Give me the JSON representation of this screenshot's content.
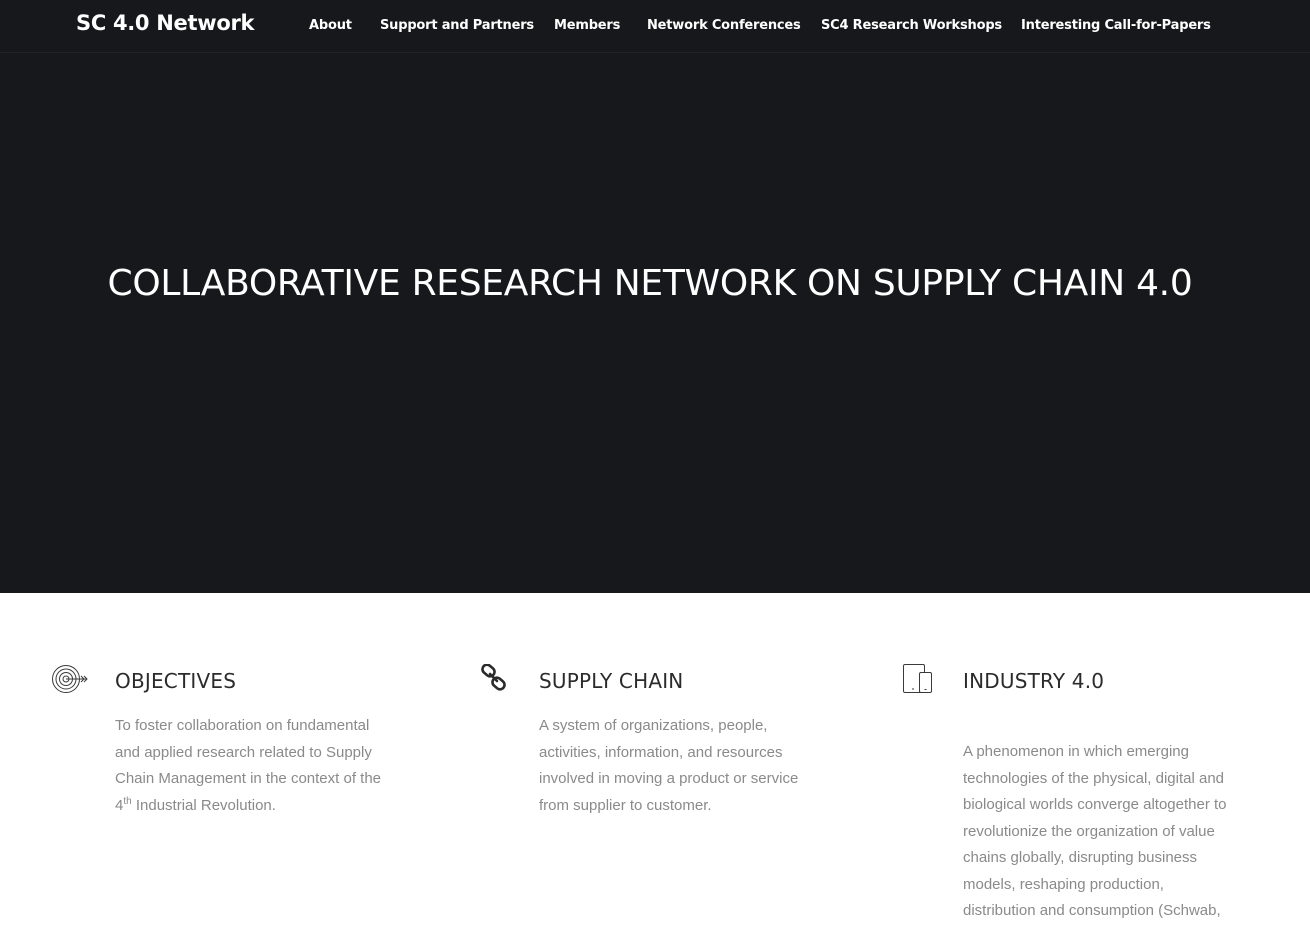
{
  "header": {
    "logo": "SC 4.0 Network",
    "nav": [
      {
        "label": "About"
      },
      {
        "label": "Support and Partners"
      },
      {
        "label": "Members"
      },
      {
        "label": "Network Conferences"
      },
      {
        "label": "SC4 Research Workshops"
      },
      {
        "label": "Interesting Call-for-Papers"
      }
    ]
  },
  "hero": {
    "title": "COLLABORATIVE RESEARCH NETWORK ON SUPPLY CHAIN 4.0"
  },
  "features": [
    {
      "icon": "target-icon",
      "title": "OBJECTIVES",
      "text_before_sup": "To foster collaboration on fundamental and applied research related to Supply Chain Management in the context of the 4",
      "sup": "th",
      "text_after_sup": " Industrial Revolution."
    },
    {
      "icon": "chain-link-icon",
      "title": "SUPPLY CHAIN",
      "text": "A system of organizations, people, activities, information, and resources involved in moving a product or service from supplier to customer."
    },
    {
      "icon": "devices-icon",
      "title": "INDUSTRY 4.0",
      "text": "A phenomenon in which emerging technologies of the physical, digital and biological worlds converge altogether to revolutionize the organization of value chains globally, disrupting business models, reshaping production, distribution and consumption (Schwab,"
    }
  ],
  "colors": {
    "header_bg": "#17181b",
    "hero_bg": "#17181b",
    "body_text": "#8a8a8a",
    "heading_text": "#2b2b2b"
  }
}
